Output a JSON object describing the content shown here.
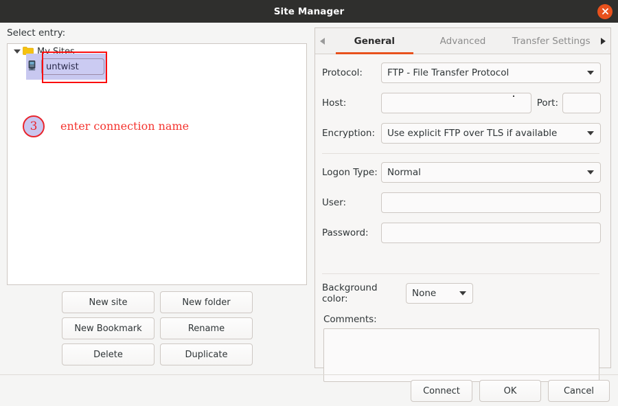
{
  "window": {
    "title": "Site Manager",
    "close_icon": "close-icon"
  },
  "left_pane": {
    "select_entry_label": "Select entry:",
    "tree": {
      "root": {
        "label": "My Sites",
        "icon": "folder-icon",
        "expander_icon": "chevron-down-icon",
        "expanded": true
      },
      "children": [
        {
          "label": "untwist",
          "icon": "server-icon",
          "editing": true,
          "selected": true
        }
      ]
    },
    "editing_value": "untwist",
    "buttons": [
      "New site",
      "New folder",
      "New Bookmark",
      "Rename",
      "Delete",
      "Duplicate"
    ]
  },
  "annotation": {
    "step_number": "3",
    "text": "enter connection name",
    "box_color": "#fb0d0d",
    "text_color": "#f4342f",
    "circle_fill": "#c9c6ef",
    "circle_border": "#e8242c"
  },
  "right_pane": {
    "tab_scroll_left_icon": "triangle-left-icon",
    "tab_scroll_right_icon": "triangle-right-icon",
    "tabs": [
      {
        "label": "General",
        "active": true
      },
      {
        "label": "Advanced",
        "active": false
      },
      {
        "label": "Transfer Settings",
        "active": false
      }
    ],
    "accent_color": "#e8511c",
    "fields": {
      "protocol": {
        "label": "Protocol:",
        "value": "FTP - File Transfer Protocol",
        "arrow_icon": "chevron-down-icon"
      },
      "host": {
        "label": "Host:",
        "value": ""
      },
      "port": {
        "label": "Port:",
        "value": ""
      },
      "encryption": {
        "label": "Encryption:",
        "value": "Use explicit FTP over TLS if available",
        "arrow_icon": "chevron-down-icon"
      },
      "logon_type": {
        "label": "Logon Type:",
        "value": "Normal",
        "arrow_icon": "chevron-down-icon"
      },
      "user": {
        "label": "User:",
        "value": ""
      },
      "password": {
        "label": "Password:",
        "value": ""
      },
      "background_color": {
        "label": "Background color:",
        "value": "None",
        "arrow_icon": "chevron-down-icon"
      },
      "comments": {
        "label": "Comments:",
        "value": ""
      }
    }
  },
  "footer": {
    "buttons": [
      "Connect",
      "OK",
      "Cancel"
    ]
  }
}
